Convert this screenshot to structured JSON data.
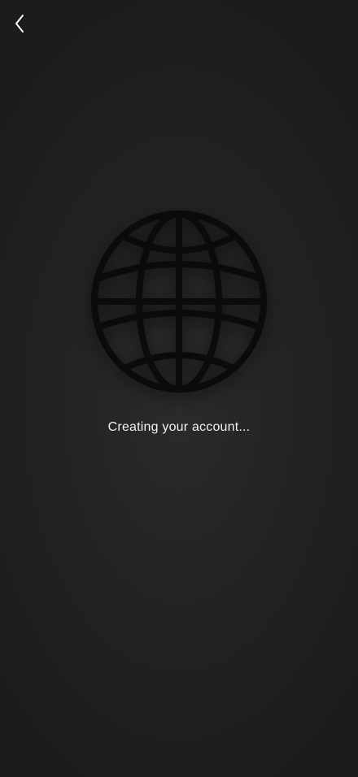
{
  "nav": {
    "back_icon": "chevron-left-icon"
  },
  "loading": {
    "icon": "globe-icon",
    "status_text": "Creating your account..."
  },
  "colors": {
    "background": "#1b1c1e",
    "globe": "#0b0b0c",
    "text": "#f2f2f2",
    "back_icon": "#ffffff"
  }
}
